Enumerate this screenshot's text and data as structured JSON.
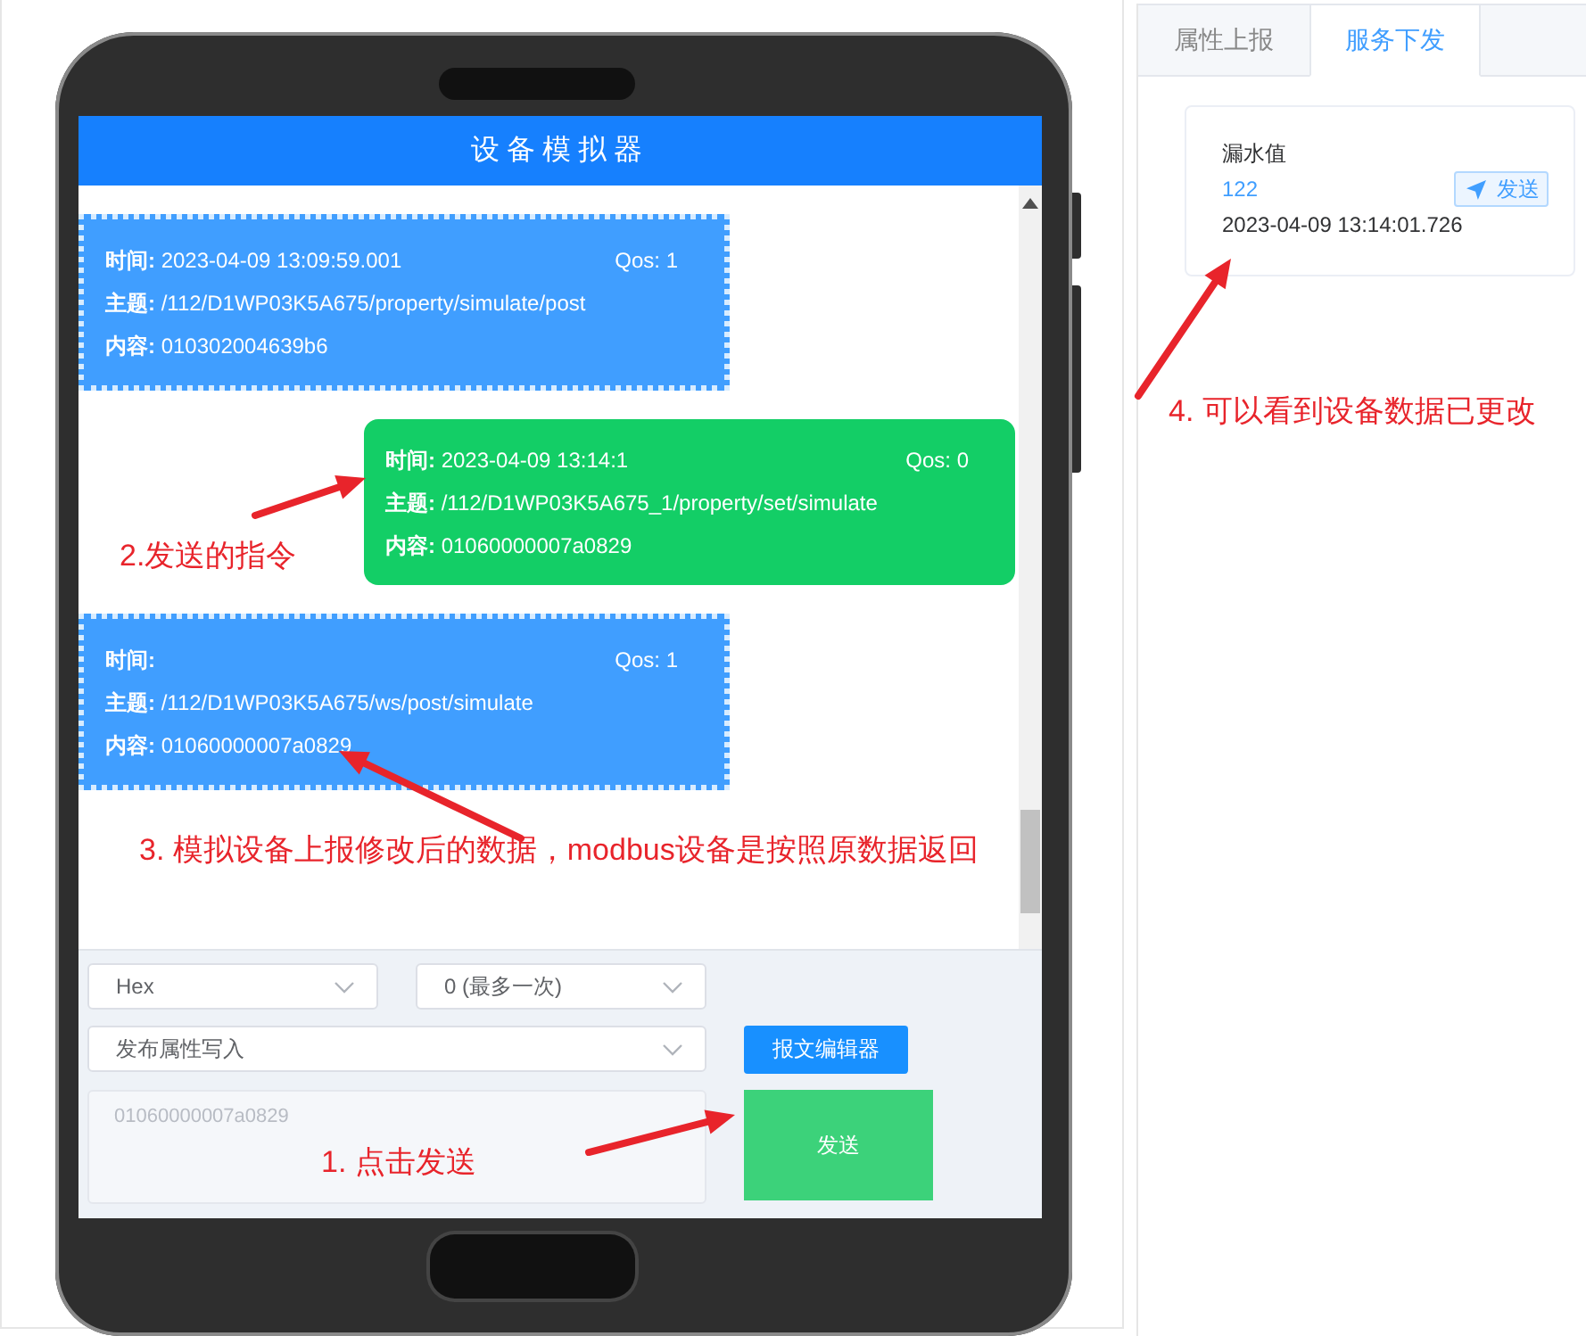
{
  "simulator": {
    "title": "设备模拟器",
    "messages": [
      {
        "kind": "received",
        "time": "**时间:** 2023-04-09 13:09:59.001",
        "qos": "Qos: 1",
        "topic": "**主题:** /112/D1WP03K5A675/property/simulate/post",
        "content": "**内容:** 010302004639b6"
      },
      {
        "kind": "sent",
        "time": "**时间:** 2023-04-09 13:14:1",
        "qos": "Qos: 0",
        "topic": "**主题:** /112/D1WP03K5A675_1/property/set/simulate",
        "content": "**内容:** 01060000007a0829"
      },
      {
        "kind": "received",
        "time": "**时间:**",
        "qos": "Qos: 1",
        "topic": "**主题:** /112/D1WP03K5A675/ws/post/simulate",
        "content": "**内容:** 01060000007a0829"
      }
    ],
    "format_select": {
      "value": "Hex"
    },
    "qos_select": {
      "value": "0 (最多一次)"
    },
    "action_select": {
      "value": "发布属性写入"
    },
    "editor_button": "报文编辑器",
    "payload": {
      "placeholder": "01060000007a0829"
    },
    "send_button": "发送"
  },
  "tabs": [
    {
      "label": "属性上报",
      "selected": false
    },
    {
      "label": "服务下发",
      "selected": true
    }
  ],
  "service_card": {
    "name": "漏水值",
    "value": "122",
    "button": "发送",
    "time": "2023-04-09 13:14:01.726"
  },
  "annotations": [
    {
      "text": "2.发送的指令"
    },
    {
      "text": "3. 模拟设备上报修改后的数据，modbus设备是按照原数据返回"
    },
    {
      "text": "1. 点击发送"
    },
    {
      "text": "4. 可以看到设备数据已更改"
    }
  ]
}
